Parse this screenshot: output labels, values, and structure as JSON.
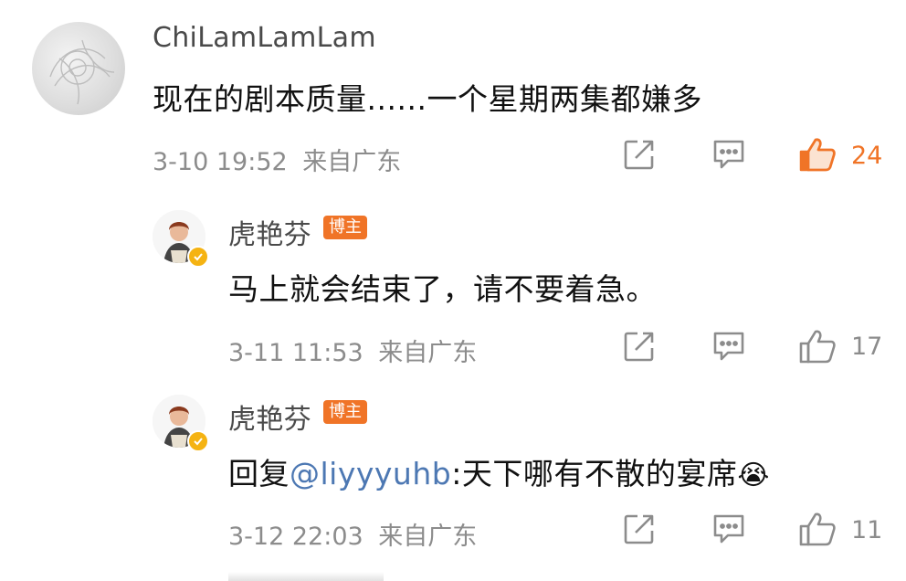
{
  "comments": [
    {
      "user": "ChiLamLamLam",
      "text": "现在的剧本质量......一个星期两集都嫌多",
      "time": "3-10 19:52",
      "location": "来自广东",
      "likes": "24"
    }
  ],
  "replies": [
    {
      "user": "虎艳芬",
      "badge": "博主",
      "text": "马上就会结束了，请不要着急。",
      "time": "3-11 11:53",
      "location": "来自广东",
      "likes": "17"
    },
    {
      "user": "虎艳芬",
      "badge": "博主",
      "reply_prefix": "回复",
      "mention": "@liyyyuhb",
      "text": ":天下哪有不散的宴席",
      "emoji": "😭",
      "time": "3-12 22:03",
      "location": "来自广东",
      "likes": "11"
    }
  ],
  "icons": [
    "share-icon",
    "comment-icon",
    "like-icon",
    "verified-icon"
  ],
  "colors": {
    "accent": "#f07427",
    "mention": "#4d78b3",
    "meta": "#8c8c8c",
    "verified": "#f5b312"
  }
}
